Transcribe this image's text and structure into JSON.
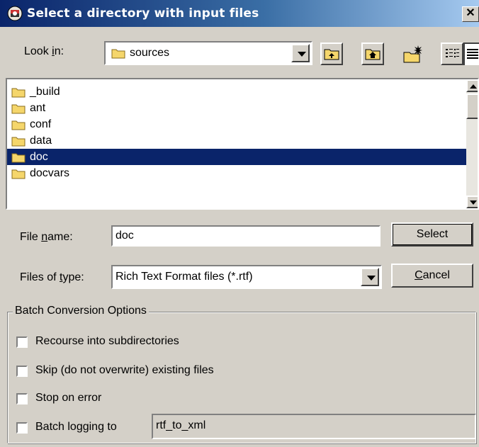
{
  "window": {
    "title": "Select a directory with input files",
    "close_glyph": "✕"
  },
  "lookin": {
    "label_pre": "Look ",
    "label_u": "i",
    "label_post": "n:",
    "value": "sources"
  },
  "toolbar": {
    "up_icon": "up-folder-icon",
    "home_icon": "home-folder-icon",
    "new_folder_icon": "new-folder-icon",
    "list_view_icon": "list-view-icon",
    "details_view_icon": "details-view-icon"
  },
  "file_list": {
    "items": [
      "_build",
      "ant",
      "conf",
      "data",
      "doc",
      "docvars"
    ],
    "selected": "doc"
  },
  "filename": {
    "label_pre": "File ",
    "label_u": "n",
    "label_post": "ame:",
    "value": "doc"
  },
  "filetype": {
    "label_pre": "Files of ",
    "label_u": "t",
    "label_post": "ype:",
    "value": "Rich Text Format files (*.rtf)"
  },
  "buttons": {
    "select": "Select",
    "cancel_u": "C",
    "cancel_rest": "ancel"
  },
  "options": {
    "group_label": "Batch Conversion Options",
    "recurse": "Recourse into subdirectories",
    "skip": "Skip (do not overwrite) existing files",
    "stop": "Stop on error",
    "batch_log": "Batch logging to",
    "batch_log_value": "rtf_to_xml",
    "recurse_checked": false,
    "skip_checked": false,
    "stop_checked": false,
    "batch_log_checked": false
  },
  "colors": {
    "selection": "#0a246a",
    "face": "#d4d0c8",
    "folder": "#f5d66b"
  }
}
